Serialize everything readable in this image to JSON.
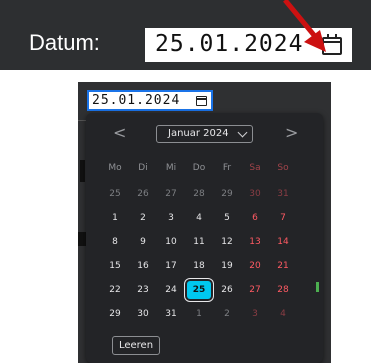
{
  "top": {
    "label": "Datum:",
    "date_value": "25.01.2024"
  },
  "lower": {
    "date_value": "25.01.2024"
  },
  "calendar": {
    "prev_symbol": "<",
    "next_symbol": ">",
    "month_label": "Januar 2024",
    "weekdays": [
      "Mo",
      "Di",
      "Mi",
      "Do",
      "Fr",
      "Sa",
      "So"
    ],
    "weeks": [
      [
        "25",
        "26",
        "27",
        "28",
        "29",
        "30",
        "31"
      ],
      [
        "1",
        "2",
        "3",
        "4",
        "5",
        "6",
        "7"
      ],
      [
        "8",
        "9",
        "10",
        "11",
        "12",
        "13",
        "14"
      ],
      [
        "15",
        "16",
        "17",
        "18",
        "19",
        "20",
        "21"
      ],
      [
        "22",
        "23",
        "24",
        "25",
        "26",
        "27",
        "28"
      ],
      [
        "29",
        "30",
        "31",
        "1",
        "2",
        "3",
        "4"
      ]
    ],
    "selected_day": "25",
    "clear_label": "Leeren"
  },
  "colors": {
    "selected": "#00c8f0",
    "weekend": "#ff5a63",
    "popup_bg": "#232427",
    "arrow": "#cc1111"
  }
}
